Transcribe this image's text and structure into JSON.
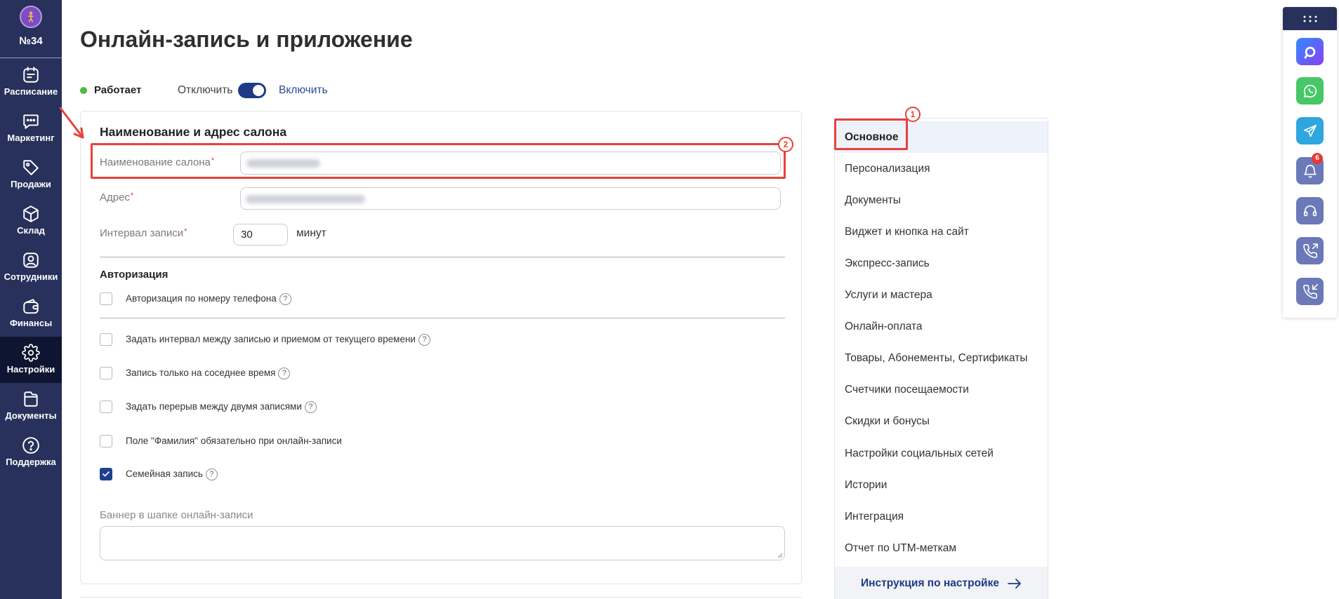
{
  "page": {
    "title": "Онлайн-запись и приложение"
  },
  "sidebar": {
    "logo_label": "№34",
    "items": [
      {
        "label": "Расписание",
        "icon": "schedule-icon",
        "active": false
      },
      {
        "label": "Маркетинг",
        "icon": "chat-bubble-icon",
        "active": false
      },
      {
        "label": "Продажи",
        "icon": "tag-icon",
        "active": false
      },
      {
        "label": "Склад",
        "icon": "box-icon",
        "active": false
      },
      {
        "label": "Сотрудники",
        "icon": "user-icon",
        "active": false
      },
      {
        "label": "Финансы",
        "icon": "wallet-icon",
        "active": false
      },
      {
        "label": "Настройки",
        "icon": "gear-icon",
        "active": true
      },
      {
        "label": "Документы",
        "icon": "document-icon",
        "active": false
      },
      {
        "label": "Поддержка",
        "icon": "help-circle-icon",
        "active": false
      }
    ]
  },
  "status": {
    "label": "Работает",
    "off_label": "Отключить",
    "on_label": "Включить",
    "enabled": true
  },
  "form": {
    "section_title": "Наименование и адрес салона",
    "required_mark": "*",
    "help_glyph": "?",
    "salon_name": {
      "label": "Наименование салона",
      "required": true
    },
    "address": {
      "label": "Адрес",
      "required": true
    },
    "interval": {
      "label": "Интервал записи",
      "required": true,
      "value": "30",
      "unit": "минут"
    },
    "auth_title": "Авторизация",
    "options": [
      {
        "label": "Авторизация по номеру телефона",
        "checked": false,
        "help": true
      },
      {
        "label": "Задать интервал между записью и приемом от текущего времени",
        "checked": false,
        "help": true
      },
      {
        "label": "Запись только на соседнее время",
        "checked": false,
        "help": true
      },
      {
        "label": "Задать перерыв между двумя записями",
        "checked": false,
        "help": true
      },
      {
        "label": "Поле \"Фамилия\" обязательно при онлайн-записи",
        "checked": false,
        "help": false
      },
      {
        "label": "Семейная запись",
        "checked": true,
        "help": true
      }
    ],
    "banner": {
      "label": "Баннер в шапке онлайн-записи",
      "value": ""
    }
  },
  "settings_nav": {
    "items": [
      {
        "label": "Основное",
        "active": true
      },
      {
        "label": "Персонализация",
        "active": false
      },
      {
        "label": "Документы",
        "active": false
      },
      {
        "label": "Виджет и кнопка на сайт",
        "active": false
      },
      {
        "label": "Экспресс-запись",
        "active": false
      },
      {
        "label": "Услуги и мастера",
        "active": false
      },
      {
        "label": "Онлайн-оплата",
        "active": false
      },
      {
        "label": "Товары, Абонементы, Сертификаты",
        "active": false
      },
      {
        "label": "Счетчики посещаемости",
        "active": false
      },
      {
        "label": "Скидки и бонусы",
        "active": false
      },
      {
        "label": "Настройки социальных сетей",
        "active": false
      },
      {
        "label": "Истории",
        "active": false
      },
      {
        "label": "Интеграция",
        "active": false
      },
      {
        "label": "Отчет по UTM-меткам",
        "active": false
      }
    ],
    "instruction_label": "Инструкция по настройке"
  },
  "widgets": {
    "items": [
      {
        "icon": "max-messenger-icon"
      },
      {
        "icon": "whatsapp-icon"
      },
      {
        "icon": "telegram-icon"
      },
      {
        "icon": "bell-icon",
        "badge": "6"
      },
      {
        "icon": "headset-icon"
      },
      {
        "icon": "phone-outgoing-icon"
      },
      {
        "icon": "phone-incoming-icon"
      }
    ]
  },
  "annotations": {
    "marker_1": "1",
    "marker_2": "2"
  },
  "colors": {
    "sidebar_bg": "#27315b",
    "sidebar_active_bg": "#0e1530",
    "accent": "#1f3a87",
    "link": "#2c4a96",
    "status_green": "#52b848",
    "annotation_red": "#e8413a",
    "nav_active_bg": "#eef2fb",
    "whatsapp": "#47c767",
    "telegram": "#2ea6e0",
    "widget_icon_bg": "#6c79b8",
    "badge_red": "#e53935"
  }
}
